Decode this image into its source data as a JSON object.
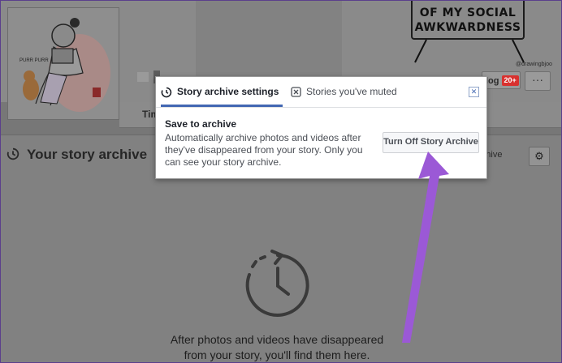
{
  "cover": {
    "text": "OF MY SOCIAL AWKWARDNESS",
    "signature": "@drawingbjoo"
  },
  "profile": {
    "pic_caption": "PURR PURR"
  },
  "header_actions": {
    "blog_label": "log",
    "blog_badge": "20+",
    "more_label": "···"
  },
  "nav": {
    "tab_label": "Tim",
    "caret": "▾"
  },
  "archive": {
    "title": "Your story archive",
    "story_link": "archive",
    "gear": "⚙",
    "empty_text": "After photos and videos have disappeared from your story, you'll find them here."
  },
  "dialog": {
    "tabs": [
      {
        "label": "Story archive settings",
        "icon": "clock-rewind-icon",
        "active": true
      },
      {
        "label": "Stories you've muted",
        "icon": "x-box-icon",
        "active": false
      }
    ],
    "close": "✕",
    "heading": "Save to archive",
    "description": "Automatically archive photos and videos after they've disappeared from your story. Only you can see your story archive.",
    "button_label": "Turn Off Story Archive"
  },
  "annotation": {
    "arrow_color": "#9b59d6"
  }
}
